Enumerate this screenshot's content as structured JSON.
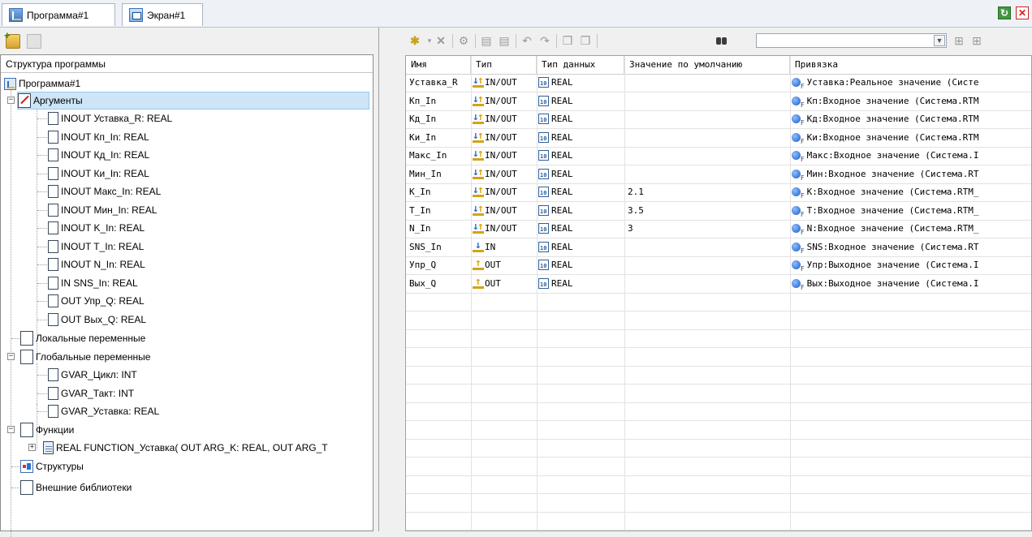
{
  "tabs": [
    {
      "label": "Программа#1",
      "icon": "program-icon",
      "active": true
    },
    {
      "label": "Экран#1",
      "icon": "screen-icon",
      "active": false
    }
  ],
  "window_buttons": {
    "refresh_icon": "refresh-icon",
    "close_icon": "close-icon"
  },
  "left_toolbar": {
    "icons": [
      "add-folder-icon",
      "delete-folder-icon"
    ]
  },
  "tree": {
    "header": "Структура программы",
    "root": "Программа#1",
    "arguments_group": "Аргументы",
    "arguments": [
      "INOUT Уставка_R: REAL",
      "INOUT Кп_In: REAL",
      "INOUT Кд_In: REAL",
      "INOUT Ки_In: REAL",
      "INOUT Макс_In: REAL",
      "INOUT Мин_In: REAL",
      "INOUT K_In: REAL",
      "INOUT T_In: REAL",
      "INOUT N_In: REAL",
      "IN SNS_In: REAL",
      "OUT Упр_Q: REAL",
      "OUT Вых_Q: REAL"
    ],
    "local_vars": "Локальные переменные",
    "global_vars": "Глобальные переменные",
    "globals": [
      "GVAR_Цикл: INT",
      "GVAR_Такт: INT",
      "GVAR_Уставка: REAL"
    ],
    "functions": "Функции",
    "function_item": "REAL FUNCTION_Уставка( OUT ARG_K: REAL, OUT ARG_T",
    "structures": "Структуры",
    "ext_libs": "Внешние библиотеки"
  },
  "search": {
    "value": ""
  },
  "grid": {
    "columns": [
      "Имя",
      "Тип",
      "Тип данных",
      "Значение по умолчанию",
      "Привязка"
    ],
    "rows": [
      {
        "name": "Уставка_R",
        "kind": "IN/OUT",
        "dtype": "REAL",
        "default": "",
        "binding": "Уставка:Реальное значение (Систе"
      },
      {
        "name": "Кп_In",
        "kind": "IN/OUT",
        "dtype": "REAL",
        "default": "",
        "binding": "Кп:Входное значение (Система.RTM"
      },
      {
        "name": "Кд_In",
        "kind": "IN/OUT",
        "dtype": "REAL",
        "default": "",
        "binding": "Кд:Входное значение (Система.RTM"
      },
      {
        "name": "Ки_In",
        "kind": "IN/OUT",
        "dtype": "REAL",
        "default": "",
        "binding": "Ки:Входное значение (Система.RTM"
      },
      {
        "name": "Макс_In",
        "kind": "IN/OUT",
        "dtype": "REAL",
        "default": "",
        "binding": "Макс:Входное значение (Система.I"
      },
      {
        "name": "Мин_In",
        "kind": "IN/OUT",
        "dtype": "REAL",
        "default": "",
        "binding": "Мин:Входное значение (Система.RT"
      },
      {
        "name": "K_In",
        "kind": "IN/OUT",
        "dtype": "REAL",
        "default": "2.1",
        "binding": "K:Входное значение (Система.RTM_"
      },
      {
        "name": "T_In",
        "kind": "IN/OUT",
        "dtype": "REAL",
        "default": "3.5",
        "binding": "T:Входное значение (Система.RTM_"
      },
      {
        "name": "N_In",
        "kind": "IN/OUT",
        "dtype": "REAL",
        "default": "3",
        "binding": "N:Входное значение (Система.RTM_"
      },
      {
        "name": "SNS_In",
        "kind": "IN",
        "dtype": "REAL",
        "default": "",
        "binding": "SNS:Входное значение (Система.RT"
      },
      {
        "name": "Упр_Q",
        "kind": "OUT",
        "dtype": "REAL",
        "default": "",
        "binding": "Упр:Выходное значение (Система.I"
      },
      {
        "name": "Вых_Q",
        "kind": "OUT",
        "dtype": "REAL",
        "default": "",
        "binding": "Вых:Выходное значение (Система.I"
      }
    ]
  }
}
